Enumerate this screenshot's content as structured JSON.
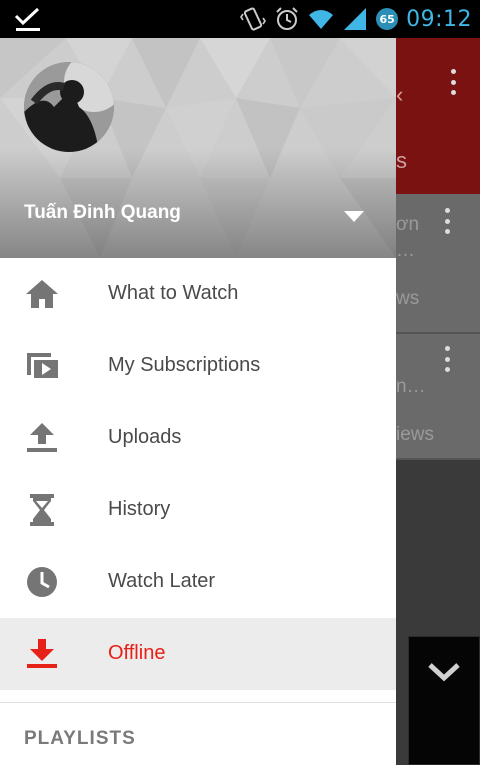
{
  "status_bar": {
    "time": "09:12",
    "battery_level": "65"
  },
  "account": {
    "name": "Tuấn Đinh Quang"
  },
  "menu": {
    "items": [
      {
        "label": "What to Watch",
        "icon": "home-icon"
      },
      {
        "label": "My Subscriptions",
        "icon": "subscriptions-icon"
      },
      {
        "label": "Uploads",
        "icon": "upload-icon"
      },
      {
        "label": "History",
        "icon": "hourglass-icon"
      },
      {
        "label": "Watch Later",
        "icon": "clock-icon"
      },
      {
        "label": "Offline",
        "icon": "download-icon",
        "active": true
      }
    ]
  },
  "sections": {
    "playlists": "PLAYLISTS"
  },
  "background": {
    "header_fragment": "s",
    "card1_line1": "ơn",
    "card1_line2": "…",
    "card1_meta": "ws",
    "card2_line1": "n…",
    "card2_meta": "iews"
  },
  "colors": {
    "accent": "#e62117",
    "status_time": "#3fb6e6",
    "menu_text": "#4a4a4a",
    "active_bg": "#ececec"
  }
}
